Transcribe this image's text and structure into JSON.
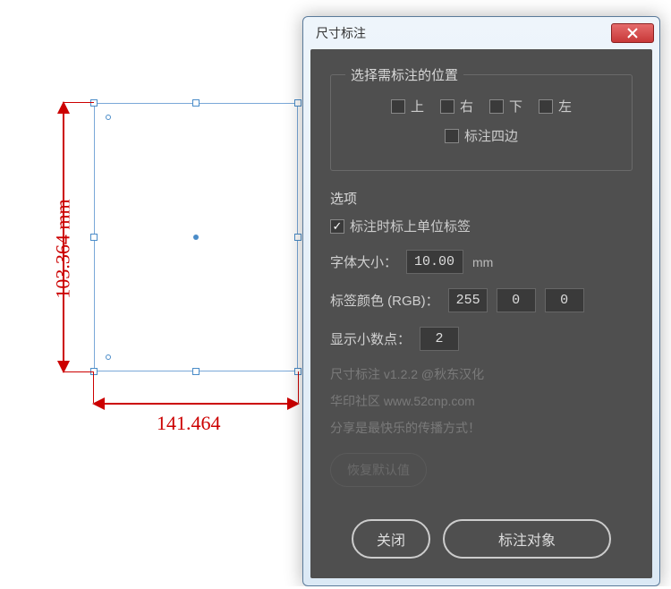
{
  "canvas": {
    "dim_v_label": "103.364 mm",
    "dim_h_label": "141.464"
  },
  "dialog": {
    "title": "尺寸标注",
    "position_group_legend": "选择需标注的位置",
    "pos": {
      "up": "上",
      "right": "右",
      "down": "下",
      "left": "左",
      "all": "标注四边"
    },
    "options_label": "选项",
    "unit_label_cb": "标注时标上单位标签",
    "font_size_label": "字体大小：",
    "font_size_value": "10.000",
    "font_size_unit": "mm",
    "color_label": "标签颜色 (RGB)：",
    "color_r": "255",
    "color_g": "0",
    "color_b": "0",
    "decimal_label": "显示小数点：",
    "decimal_value": "2",
    "credit_line1": "尺寸标注 v1.2.2 @秋东汉化",
    "credit_line2": "华印社区  www.52cnp.com",
    "credit_line3": "分享是最快乐的传播方式！",
    "restore_label": "恢复默认值",
    "close_label": "关闭",
    "apply_label": "标注对象"
  }
}
